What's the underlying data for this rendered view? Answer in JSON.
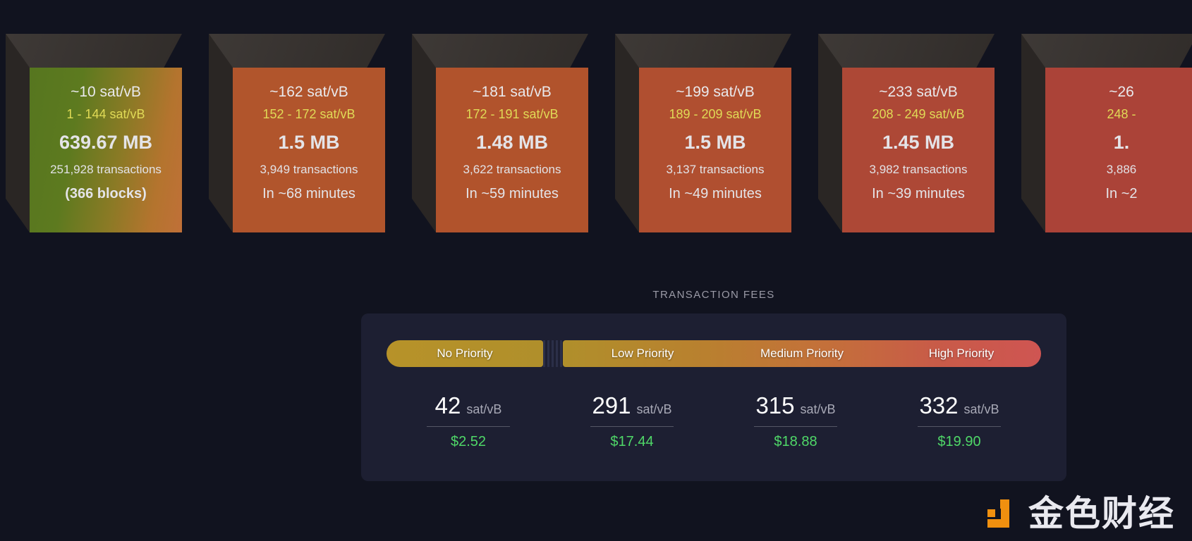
{
  "theme": {
    "background": "#11131f",
    "panel_bg": "#1d1f32",
    "accent_yellow": "#e0da56",
    "accent_green": "#4fd868",
    "logo_orange": "#f0900f"
  },
  "mempool_blocks": [
    {
      "median_fee": "~10 sat/vB",
      "fee_range": "1 - 144 sat/vB",
      "size": "639.67 MB",
      "transactions": "251,928 transactions",
      "eta": "(366 blocks)",
      "eta_bold": true,
      "face_color": "linear-gradient(100deg, #56761f 0%, #5d7a1f 30%, #8a7a25 58%, #b4742e 82%, #c07038 100%)"
    },
    {
      "median_fee": "~162 sat/vB",
      "fee_range": "152 - 172 sat/vB",
      "size": "1.5 MB",
      "transactions": "3,949 transactions",
      "eta": "In ~68 minutes",
      "eta_bold": false,
      "face_color": "#b1552c"
    },
    {
      "median_fee": "~181 sat/vB",
      "fee_range": "172 - 191 sat/vB",
      "size": "1.48 MB",
      "transactions": "3,622 transactions",
      "eta": "In ~59 minutes",
      "eta_bold": false,
      "face_color": "#b1532c"
    },
    {
      "median_fee": "~199 sat/vB",
      "fee_range": "189 - 209 sat/vB",
      "size": "1.5 MB",
      "transactions": "3,137 transactions",
      "eta": "In ~49 minutes",
      "eta_bold": false,
      "face_color": "#b04f30"
    },
    {
      "median_fee": "~233 sat/vB",
      "fee_range": "208 - 249 sat/vB",
      "size": "1.45 MB",
      "transactions": "3,982 transactions",
      "eta": "In ~39 minutes",
      "eta_bold": false,
      "face_color": "#ad4836"
    },
    {
      "median_fee": "~26",
      "fee_range": "248 -",
      "size": "1.",
      "transactions": "3,886",
      "eta": "In ~2",
      "eta_bold": false,
      "face_color": "#ab4338"
    }
  ],
  "transaction_fees": {
    "heading": "TRANSACTION FEES",
    "priority_segments": [
      {
        "label": "No Priority"
      },
      {
        "label": "Low Priority"
      },
      {
        "label": "Medium Priority"
      },
      {
        "label": "High Priority"
      }
    ],
    "columns": [
      {
        "rate": "42",
        "unit": "sat/vB",
        "usd": "$2.52"
      },
      {
        "rate": "291",
        "unit": "sat/vB",
        "usd": "$17.44"
      },
      {
        "rate": "315",
        "unit": "sat/vB",
        "usd": "$18.88"
      },
      {
        "rate": "332",
        "unit": "sat/vB",
        "usd": "$19.90"
      }
    ]
  },
  "watermark": {
    "text": "金色财经"
  }
}
